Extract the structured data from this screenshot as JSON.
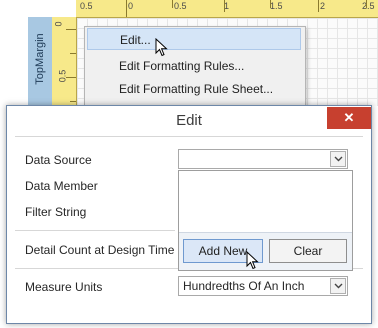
{
  "ruler": {
    "top_labels": [
      "0.5",
      "0",
      "0.5",
      "1",
      "1.5",
      "2",
      "2.5"
    ],
    "left_labels": [
      "0",
      "0.5"
    ]
  },
  "band": {
    "label": "TopMargin"
  },
  "context_menu": {
    "items": [
      {
        "label": "Edit..."
      },
      {
        "label": "Edit Formatting Rules..."
      },
      {
        "label": "Edit Formatting Rule Sheet..."
      }
    ]
  },
  "dialog": {
    "title": "Edit",
    "close_glyph": "✕",
    "rows": [
      {
        "label": "Data Source"
      },
      {
        "label": "Data Member"
      },
      {
        "label": "Filter String"
      },
      {
        "label": "Detail Count at Design Time"
      },
      {
        "label": "Measure Units"
      }
    ],
    "data_source_value": "",
    "measure_units_value": "Hundredths Of An Inch",
    "dropdown": {
      "add_new_label": "Add New",
      "clear_label": "Clear"
    }
  },
  "colors": {
    "close_button": "#c7402f",
    "menu_highlight": "#d5e5f7",
    "ruler": "#f7e98a",
    "margin_band": "#a8c8e2"
  }
}
